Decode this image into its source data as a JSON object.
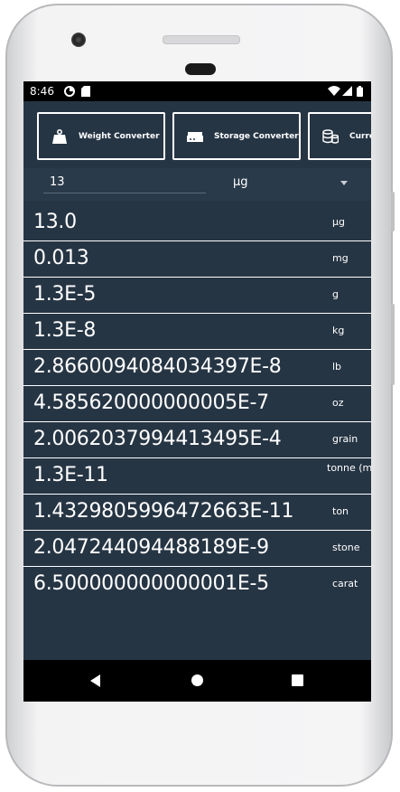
{
  "statusbar": {
    "time": "8:46"
  },
  "converters": [
    {
      "label": "Weight Converter",
      "icon": "weight-icon"
    },
    {
      "label": "Storage Converter",
      "icon": "storage-icon"
    },
    {
      "label": "Curre",
      "icon": "currency-icon"
    }
  ],
  "input": {
    "value": "13",
    "unit": "µg"
  },
  "results": [
    {
      "value": "13.0",
      "unit": "µg"
    },
    {
      "value": "0.013",
      "unit": "mg"
    },
    {
      "value": "1.3E-5",
      "unit": "g"
    },
    {
      "value": "1.3E-8",
      "unit": "kg"
    },
    {
      "value": "2.8660094084034397E-8",
      "unit": "lb"
    },
    {
      "value": "4.585620000000005E-7",
      "unit": "oz"
    },
    {
      "value": "2.0062037994413495E-4",
      "unit": "grain"
    },
    {
      "value": "1.3E-11",
      "unit": "tonne (metric)"
    },
    {
      "value": "1.4329805996472663E-11",
      "unit": "ton"
    },
    {
      "value": "2.047244094488189E-9",
      "unit": "stone"
    },
    {
      "value": "6.500000000000001E-5",
      "unit": "carat"
    }
  ],
  "navbar": {
    "back": "back-icon",
    "home": "home-icon",
    "recents": "recents-icon"
  }
}
